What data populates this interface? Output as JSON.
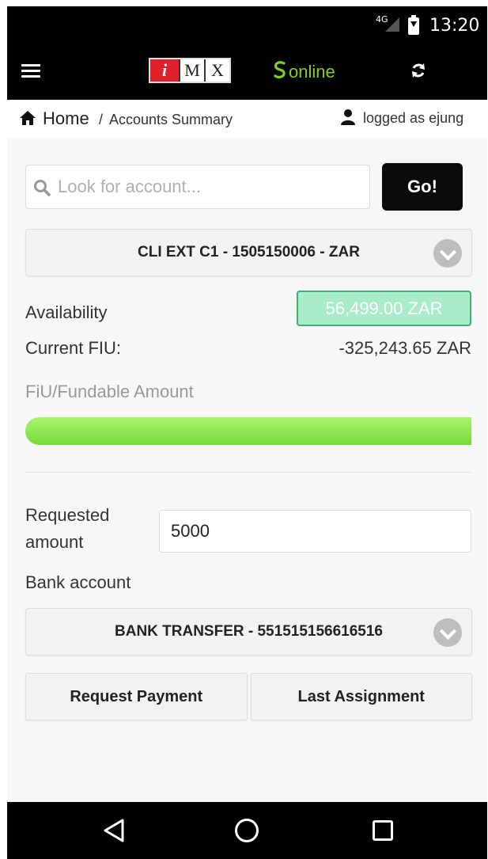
{
  "status_bar": {
    "network": "4G",
    "time": "13:20"
  },
  "app_bar": {
    "logo_letters": [
      "i",
      "M",
      "X"
    ],
    "online_icon": "ꜱ",
    "online_label": "online",
    "icons": [
      "hamburger-icon",
      "refresh-icon"
    ],
    "accent_color": "#7ed321",
    "logo_red": "#e0212b"
  },
  "breadcrumb": {
    "home": "Home",
    "separator": "/",
    "current": "Accounts Summary",
    "logged_as": "logged as ejung"
  },
  "search": {
    "placeholder": "Look for account...",
    "value": "",
    "go_label": "Go!"
  },
  "account_select": {
    "selected": "CLI EXT C1 - 1505150006 - ZAR"
  },
  "availability": {
    "label": "Availability",
    "value": "56,499.00 ZAR",
    "badge_color": "#a8ecc9"
  },
  "current_fiu": {
    "label": "Current FIU:",
    "value": "-325,243.65 ZAR"
  },
  "fundable": {
    "label": "FiU/Fundable Amount",
    "progress": 1.0,
    "bar_color": "#8ee24c"
  },
  "request": {
    "amount_label_line1": "Requested",
    "amount_label_line2": "amount",
    "amount_value": "5000",
    "bank_label": "Bank account",
    "bank_selected": "BANK TRANSFER - 551515156616516"
  },
  "actions": {
    "request_payment": "Request Payment",
    "last_assignment": "Last Assignment"
  }
}
